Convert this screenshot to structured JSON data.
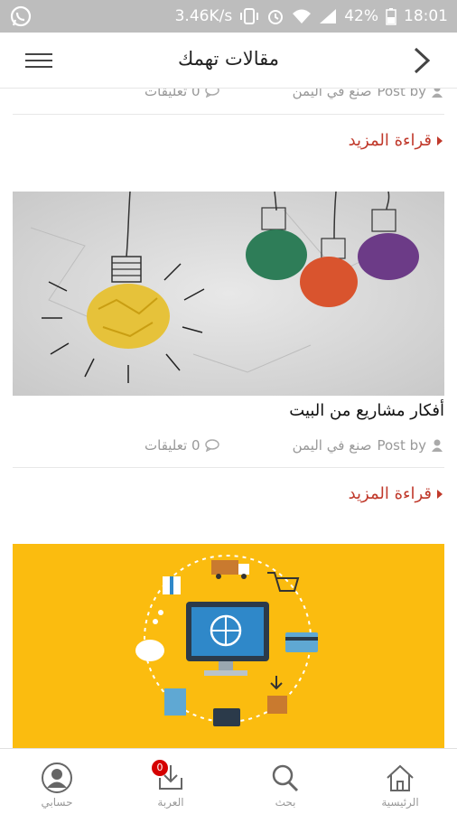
{
  "status_bar": {
    "speed": "3.46K/s",
    "battery": "42%",
    "time": "18:01"
  },
  "app_bar": {
    "title": "مقالات تهمك"
  },
  "posts": [
    {
      "author_label": "Post by",
      "author": "صنع في اليمن",
      "comments": "0 تعليقات",
      "read_more": "قراءة المزيد"
    },
    {
      "title": "أفكار مشاريع من البيت",
      "author_label": "Post by",
      "author": "صنع في اليمن",
      "comments": "0 تعليقات",
      "read_more": "قراءة المزيد"
    }
  ],
  "bottom_nav": {
    "items": [
      {
        "label": "حسابي",
        "icon": "account-icon"
      },
      {
        "label": "العربة",
        "icon": "cart-download-icon",
        "badge": "0"
      },
      {
        "label": "بحث",
        "icon": "search-icon"
      },
      {
        "label": "الرئيسية",
        "icon": "home-icon"
      }
    ]
  },
  "colors": {
    "accent": "#c0392b",
    "status_bar": "#bdbdbd",
    "yellow_banner": "#fbbc0f"
  }
}
